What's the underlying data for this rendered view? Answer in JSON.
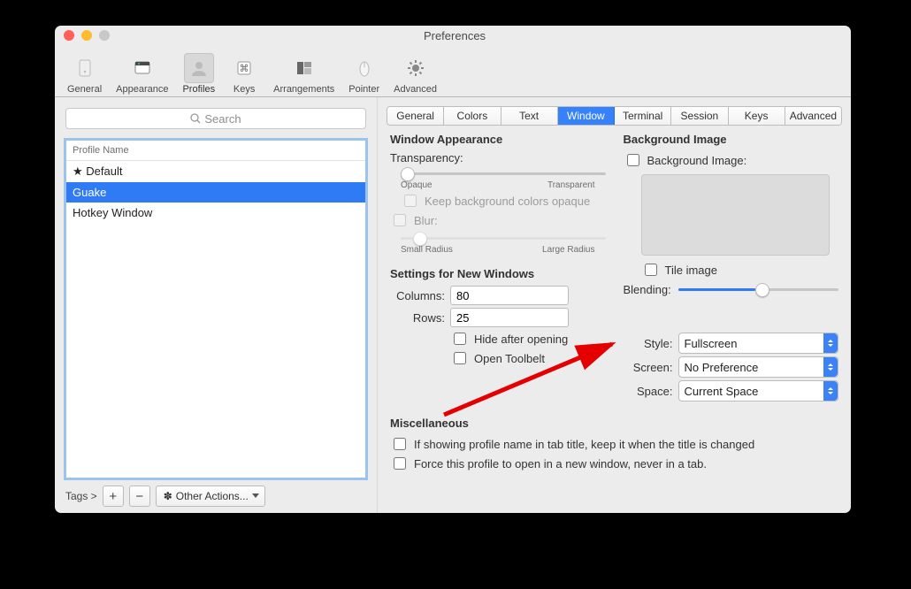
{
  "window": {
    "title": "Preferences"
  },
  "toolbar": [
    {
      "label": "General"
    },
    {
      "label": "Appearance"
    },
    {
      "label": "Profiles"
    },
    {
      "label": "Keys"
    },
    {
      "label": "Arrangements"
    },
    {
      "label": "Pointer"
    },
    {
      "label": "Advanced"
    }
  ],
  "sidebar": {
    "search_placeholder": "Search",
    "header": "Profile Name",
    "profiles": [
      "★ Default",
      "Guake",
      "Hotkey Window"
    ],
    "tags_label": "Tags >",
    "other_actions": "Other Actions..."
  },
  "tabs": [
    "General",
    "Colors",
    "Text",
    "Window",
    "Terminal",
    "Session",
    "Keys",
    "Advanced"
  ],
  "panel": {
    "appearance": {
      "title": "Window Appearance",
      "transparency_label": "Transparency:",
      "opaque": "Opaque",
      "transparent": "Transparent",
      "keep_bg_opaque": "Keep background colors opaque",
      "blur_label": "Blur:",
      "small_radius": "Small Radius",
      "large_radius": "Large Radius"
    },
    "bg": {
      "title": "Background Image",
      "checkbox_label": "Background Image:",
      "tile_label": "Tile image",
      "blending_label": "Blending:"
    },
    "new_windows": {
      "title": "Settings for New Windows",
      "columns_label": "Columns:",
      "columns_value": "80",
      "rows_label": "Rows:",
      "rows_value": "25",
      "hide_after_opening": "Hide after opening",
      "open_toolbelt": "Open Toolbelt",
      "style_label": "Style:",
      "style_value": "Fullscreen",
      "screen_label": "Screen:",
      "screen_value": "No Preference",
      "space_label": "Space:",
      "space_value": "Current Space"
    },
    "misc": {
      "title": "Miscellaneous",
      "keep_profile_name": "If showing profile name in tab title, keep it when the title is changed",
      "force_new_window": "Force this profile to open in a new window, never in a tab."
    }
  }
}
